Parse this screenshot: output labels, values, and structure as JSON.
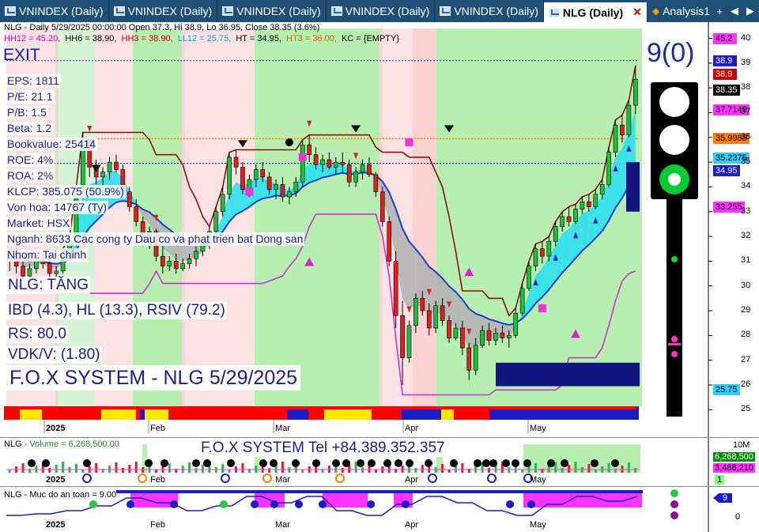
{
  "tabs": [
    {
      "label": "VNINDEX (Daily)",
      "active": false
    },
    {
      "label": "VNINDEX (Daily)",
      "active": false
    },
    {
      "label": "VNINDEX (Daily)",
      "active": false
    },
    {
      "label": "VNINDEX (Daily)",
      "active": false
    },
    {
      "label": "VNINDEX (Daily)",
      "active": false
    },
    {
      "label": "NLG (Daily)",
      "active": true
    },
    {
      "label": "Analysis1",
      "active": false
    }
  ],
  "tab_nav": {
    "add": "+",
    "prev": "◀",
    "next": "▶"
  },
  "header": {
    "info_line": "NLG - Daily 5/29/2025 00:00:00 Open 37.3, Hi 38.9, Lo 36.95, Close 38.35 (3.6%)",
    "levels": [
      {
        "text": "HH12 = 45.20,",
        "color": "#cc00cc"
      },
      {
        "text": "HH6 = 38.90,",
        "color": "#000000"
      },
      {
        "text": "HH3 = 38.90,",
        "color": "#cc0000"
      },
      {
        "text": "LL12 = 25.75,",
        "color": "#00a8d8"
      },
      {
        "text": "HT = 34.95,",
        "color": "#000000"
      },
      {
        "text": "HT3 = 36.00,",
        "color": "#e06000"
      },
      {
        "text": "KC = {EMPTY}",
        "color": "#000000"
      }
    ]
  },
  "exit_label": "EXIT",
  "signal_count": "9(0)",
  "fundamentals": [
    "EPS: 1811",
    "P/E: 21.1",
    "P/B: 1.5",
    "Beta: 1.2",
    "Bookvalue: 25414",
    "ROE: 4%",
    "ROA: 2%",
    "KLCP: 385.075 (50.9%)",
    "Von hoa: 14767 (Ty)",
    "Market: HSX",
    "Nganh: 8633 Cac cong ty Dau co va phat trien bat Dong san",
    "Nhom: Tai chinh"
  ],
  "summary": [
    "NLG: TĂNG",
    "IBD (4.3), HL (13.3), RSIV (79.2)",
    "RS: 80.0",
    "VDK/V:  (1.80)"
  ],
  "title_box": "F.O.X SYSTEM - NLG 5/29/2025",
  "price_axis": {
    "min": 24.5,
    "max": 40.4,
    "labels": [
      40,
      39,
      38,
      37,
      36,
      35,
      34,
      33,
      32,
      31,
      30,
      29,
      28,
      27,
      26,
      25
    ]
  },
  "price_tags": [
    {
      "text": "45.2",
      "value": 40.0,
      "bg": "#ff33ff",
      "fg": "#000000"
    },
    {
      "text": "38.9",
      "value": 39.1,
      "bg": "#1c1cc8",
      "fg": "#ffffff"
    },
    {
      "text": "38.9",
      "value": 38.55,
      "bg": "#cc0000",
      "fg": "#ffffff"
    },
    {
      "text": "38.35",
      "value": 37.9,
      "bg": "#000000",
      "fg": "#ffffff"
    },
    {
      "text": "37.7149",
      "value": 37.1,
      "bg": "#ff33ff",
      "fg": "#000000"
    },
    {
      "text": "35.9985",
      "value": 35.95,
      "bg": "#ff7f00",
      "fg": "#000000"
    },
    {
      "text": "35.2375",
      "value": 35.15,
      "bg": "#33ccff",
      "fg": "#000000"
    },
    {
      "text": "34.95",
      "value": 34.65,
      "bg": "#1c1cc8",
      "fg": "#ffffff"
    },
    {
      "text": "33.255",
      "value": 33.2,
      "bg": "#ff33ff",
      "fg": "#000000"
    },
    {
      "text": "25.75",
      "value": 25.8,
      "bg": "#33ccff",
      "fg": "#000000"
    }
  ],
  "months": [
    {
      "label": "2025",
      "x": 58,
      "year": true
    },
    {
      "label": "Feb",
      "x": 190,
      "year": false
    },
    {
      "label": "Mar",
      "x": 348,
      "year": false
    },
    {
      "label": "Apr",
      "x": 512,
      "year": false
    },
    {
      "label": "May",
      "x": 670,
      "year": false
    }
  ],
  "chart_data": {
    "type": "candlestick",
    "symbol": "NLG",
    "ylim": [
      24.5,
      40.4
    ],
    "candles": [
      [
        31.0,
        31.5,
        30.6,
        31.2
      ],
      [
        31.2,
        31.4,
        30.5,
        30.8
      ],
      [
        30.8,
        31.0,
        30.2,
        30.4
      ],
      [
        30.4,
        30.9,
        30.2,
        30.7
      ],
      [
        30.7,
        31.3,
        30.5,
        31.1
      ],
      [
        31.1,
        31.3,
        30.7,
        30.9
      ],
      [
        30.9,
        31.1,
        30.3,
        30.5
      ],
      [
        30.5,
        30.8,
        30.1,
        30.6
      ],
      [
        30.6,
        31.5,
        30.5,
        31.3
      ],
      [
        31.3,
        32.0,
        31.1,
        31.8
      ],
      [
        31.8,
        34.0,
        31.6,
        33.8
      ],
      [
        33.8,
        36.2,
        33.5,
        35.6
      ],
      [
        35.6,
        35.9,
        34.4,
        34.8
      ],
      [
        34.8,
        35.1,
        34.1,
        34.4
      ],
      [
        34.4,
        34.8,
        33.9,
        34.6
      ],
      [
        34.6,
        35.2,
        34.3,
        35.0
      ],
      [
        35.0,
        35.3,
        34.6,
        34.7
      ],
      [
        34.7,
        34.9,
        33.6,
        33.8
      ],
      [
        33.8,
        34.0,
        33.0,
        33.2
      ],
      [
        33.2,
        33.5,
        32.4,
        32.6
      ],
      [
        32.6,
        32.8,
        31.6,
        31.8
      ],
      [
        31.8,
        32.4,
        31.5,
        32.2
      ],
      [
        32.2,
        32.3,
        31.0,
        31.2
      ],
      [
        31.2,
        31.6,
        30.5,
        30.8
      ],
      [
        30.8,
        31.2,
        30.6,
        31.0
      ],
      [
        31.0,
        31.3,
        30.5,
        30.7
      ],
      [
        30.7,
        31.1,
        30.6,
        30.9
      ],
      [
        30.9,
        31.3,
        30.7,
        31.1
      ],
      [
        31.1,
        31.6,
        30.8,
        31.4
      ],
      [
        31.4,
        31.9,
        31.2,
        31.7
      ],
      [
        31.7,
        32.4,
        31.5,
        32.2
      ],
      [
        32.2,
        33.2,
        32.0,
        33.0
      ],
      [
        33.0,
        34.0,
        32.8,
        33.7
      ],
      [
        33.7,
        35.4,
        33.5,
        35.2
      ],
      [
        35.2,
        35.5,
        34.5,
        34.8
      ],
      [
        34.8,
        35.0,
        33.7,
        33.9
      ],
      [
        33.9,
        34.5,
        33.6,
        34.3
      ],
      [
        34.3,
        34.9,
        34.0,
        34.7
      ],
      [
        34.7,
        35.0,
        34.2,
        34.4
      ],
      [
        34.4,
        34.6,
        33.7,
        33.9
      ],
      [
        33.9,
        34.3,
        33.5,
        34.1
      ],
      [
        34.1,
        34.4,
        33.4,
        33.6
      ],
      [
        33.6,
        34.0,
        33.3,
        33.8
      ],
      [
        33.8,
        34.4,
        33.6,
        34.2
      ],
      [
        34.2,
        35.9,
        34.0,
        35.7
      ],
      [
        35.7,
        36.1,
        35.0,
        35.3
      ],
      [
        35.3,
        35.6,
        34.7,
        34.9
      ],
      [
        34.9,
        35.3,
        34.6,
        35.1
      ],
      [
        35.1,
        35.4,
        34.7,
        34.8
      ],
      [
        34.8,
        35.2,
        34.5,
        35.0
      ],
      [
        35.0,
        35.4,
        34.6,
        34.9
      ],
      [
        34.9,
        35.1,
        34.0,
        34.2
      ],
      [
        34.2,
        34.8,
        34.0,
        34.6
      ],
      [
        34.6,
        35.1,
        34.3,
        34.9
      ],
      [
        34.9,
        35.2,
        34.4,
        34.5
      ],
      [
        34.5,
        34.6,
        33.6,
        33.8
      ],
      [
        33.8,
        34.0,
        32.4,
        32.6
      ],
      [
        32.6,
        32.8,
        30.8,
        31.0
      ],
      [
        31.0,
        31.4,
        28.3,
        28.8
      ],
      [
        28.8,
        29.4,
        26.0,
        27.1
      ],
      [
        27.1,
        28.6,
        26.9,
        28.4
      ],
      [
        28.4,
        29.7,
        28.1,
        29.5
      ],
      [
        29.5,
        29.8,
        28.8,
        29.0
      ],
      [
        29.0,
        29.3,
        28.0,
        28.3
      ],
      [
        28.3,
        29.4,
        28.1,
        29.2
      ],
      [
        29.2,
        29.5,
        28.4,
        28.6
      ],
      [
        28.6,
        28.8,
        27.7,
        27.9
      ],
      [
        27.9,
        28.5,
        27.8,
        28.3
      ],
      [
        28.3,
        28.6,
        27.2,
        27.5
      ],
      [
        27.5,
        27.7,
        26.2,
        26.6
      ],
      [
        26.6,
        27.9,
        26.4,
        27.6
      ],
      [
        27.6,
        28.4,
        27.5,
        28.2
      ],
      [
        28.2,
        28.5,
        27.6,
        27.8
      ],
      [
        27.8,
        28.3,
        27.6,
        28.1
      ],
      [
        28.1,
        28.4,
        27.7,
        27.9
      ],
      [
        27.9,
        28.2,
        27.5,
        28.0
      ],
      [
        28.0,
        29.1,
        27.9,
        28.9
      ],
      [
        28.9,
        30.1,
        28.8,
        29.9
      ],
      [
        29.9,
        31.0,
        29.8,
        30.8
      ],
      [
        30.8,
        31.7,
        30.6,
        31.5
      ],
      [
        31.5,
        31.8,
        30.9,
        31.2
      ],
      [
        31.2,
        32.0,
        31.0,
        31.8
      ],
      [
        31.8,
        32.6,
        31.6,
        32.4
      ],
      [
        32.4,
        33.0,
        32.2,
        32.8
      ],
      [
        32.8,
        33.2,
        32.4,
        32.6
      ],
      [
        32.6,
        33.3,
        32.5,
        33.1
      ],
      [
        33.1,
        33.6,
        32.9,
        33.4
      ],
      [
        33.4,
        33.7,
        33.0,
        33.2
      ],
      [
        33.2,
        33.9,
        33.1,
        33.7
      ],
      [
        33.7,
        34.3,
        33.5,
        34.1
      ],
      [
        34.1,
        35.6,
        34.0,
        35.4
      ],
      [
        35.4,
        36.7,
        35.2,
        36.5
      ],
      [
        36.5,
        36.9,
        35.8,
        36.1
      ],
      [
        36.1,
        37.5,
        36.0,
        37.3
      ],
      [
        37.3,
        38.9,
        36.95,
        38.35
      ]
    ]
  },
  "volume_panel": {
    "header_name": "NLG",
    "header_label": " - Volume = 6,268,500.00",
    "tel": "F.O.X SYSTEM Tel +84.389.352.357",
    "axis_top": "10M",
    "tag_current": "6,268,500",
    "tag_avg": "3,488,210",
    "tag_small": "1"
  },
  "safety_panel": {
    "header": "NLG - Muc do an toan = 9.00",
    "tag_value": "9",
    "axis_zero": "0"
  }
}
